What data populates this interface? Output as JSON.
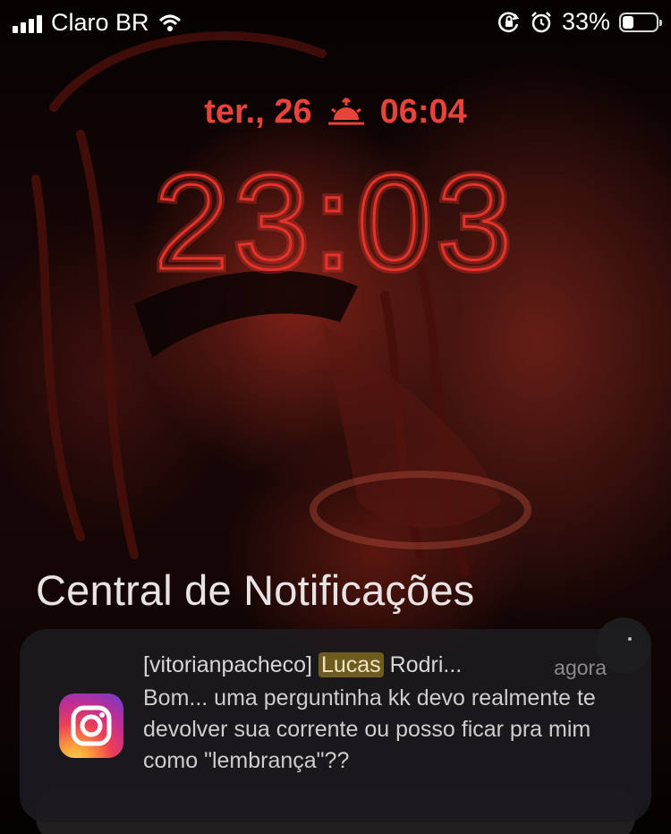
{
  "status_bar": {
    "carrier": "Claro BR",
    "battery_percent_label": "33%",
    "battery_level": 0.33,
    "icons": [
      "signal-icon",
      "wifi-icon",
      "orientation-lock-icon",
      "alarm-icon",
      "battery-icon"
    ]
  },
  "lock_screen": {
    "date": "ter., 26",
    "alarm_icon": "sunrise-icon",
    "alarm_time": "06:04",
    "time": "23:03",
    "accent_color": "#e8433a"
  },
  "notification_center": {
    "title": "Central de Notificações"
  },
  "notification": {
    "app_icon": "instagram-icon",
    "sender_prefix": "[vitorianpacheco]",
    "sender_highlight": "Lucas",
    "sender_suffix": "Rodri...",
    "time": "agora",
    "body": "Bom... uma perguntinha kk devo realmente te devolver sua corrente ou posso ficar pra mim como \"lembrança\"??"
  }
}
